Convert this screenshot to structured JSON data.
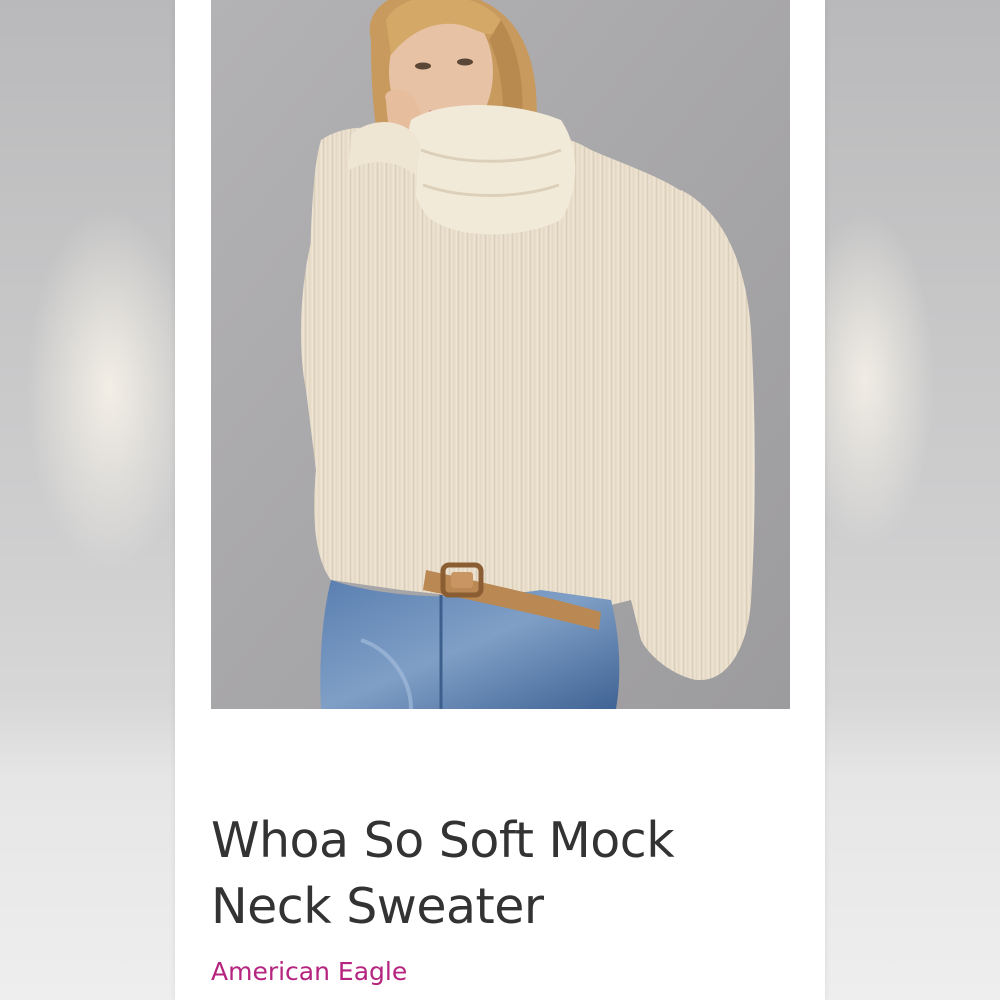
{
  "listing": {
    "title": "Whoa So Soft Mock Neck Sweater",
    "brand": "American Eagle"
  },
  "photo": {
    "subject": "model wearing cream mock neck sweater with blue jeans and tan belt"
  },
  "colors": {
    "brand_link": "#b5247e",
    "title_text": "#333333",
    "photo_background": "#a5a4a6",
    "sweater": "#efe6d6"
  }
}
